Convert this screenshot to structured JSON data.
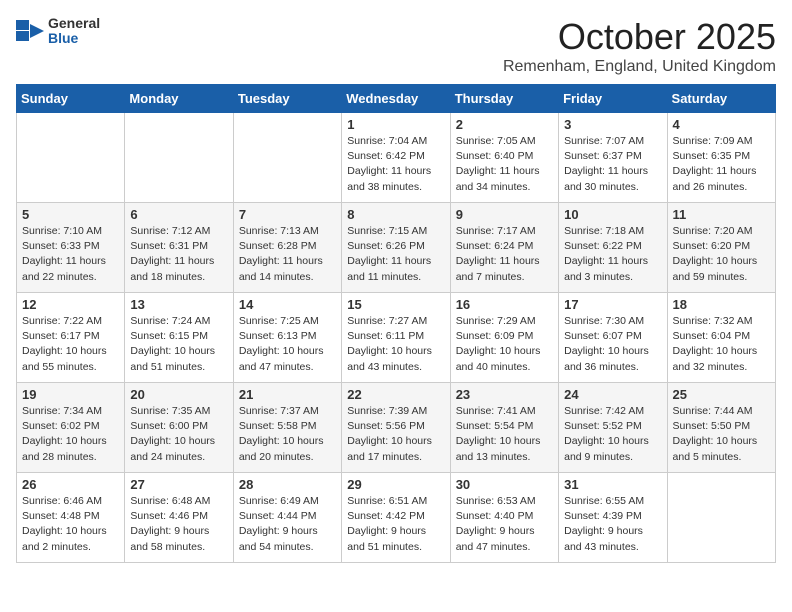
{
  "header": {
    "logo_general": "General",
    "logo_blue": "Blue",
    "month": "October 2025",
    "location": "Remenham, England, United Kingdom"
  },
  "weekdays": [
    "Sunday",
    "Monday",
    "Tuesday",
    "Wednesday",
    "Thursday",
    "Friday",
    "Saturday"
  ],
  "weeks": [
    [
      {
        "day": "",
        "info": ""
      },
      {
        "day": "",
        "info": ""
      },
      {
        "day": "",
        "info": ""
      },
      {
        "day": "1",
        "info": "Sunrise: 7:04 AM\nSunset: 6:42 PM\nDaylight: 11 hours and 38 minutes."
      },
      {
        "day": "2",
        "info": "Sunrise: 7:05 AM\nSunset: 6:40 PM\nDaylight: 11 hours and 34 minutes."
      },
      {
        "day": "3",
        "info": "Sunrise: 7:07 AM\nSunset: 6:37 PM\nDaylight: 11 hours and 30 minutes."
      },
      {
        "day": "4",
        "info": "Sunrise: 7:09 AM\nSunset: 6:35 PM\nDaylight: 11 hours and 26 minutes."
      }
    ],
    [
      {
        "day": "5",
        "info": "Sunrise: 7:10 AM\nSunset: 6:33 PM\nDaylight: 11 hours and 22 minutes."
      },
      {
        "day": "6",
        "info": "Sunrise: 7:12 AM\nSunset: 6:31 PM\nDaylight: 11 hours and 18 minutes."
      },
      {
        "day": "7",
        "info": "Sunrise: 7:13 AM\nSunset: 6:28 PM\nDaylight: 11 hours and 14 minutes."
      },
      {
        "day": "8",
        "info": "Sunrise: 7:15 AM\nSunset: 6:26 PM\nDaylight: 11 hours and 11 minutes."
      },
      {
        "day": "9",
        "info": "Sunrise: 7:17 AM\nSunset: 6:24 PM\nDaylight: 11 hours and 7 minutes."
      },
      {
        "day": "10",
        "info": "Sunrise: 7:18 AM\nSunset: 6:22 PM\nDaylight: 11 hours and 3 minutes."
      },
      {
        "day": "11",
        "info": "Sunrise: 7:20 AM\nSunset: 6:20 PM\nDaylight: 10 hours and 59 minutes."
      }
    ],
    [
      {
        "day": "12",
        "info": "Sunrise: 7:22 AM\nSunset: 6:17 PM\nDaylight: 10 hours and 55 minutes."
      },
      {
        "day": "13",
        "info": "Sunrise: 7:24 AM\nSunset: 6:15 PM\nDaylight: 10 hours and 51 minutes."
      },
      {
        "day": "14",
        "info": "Sunrise: 7:25 AM\nSunset: 6:13 PM\nDaylight: 10 hours and 47 minutes."
      },
      {
        "day": "15",
        "info": "Sunrise: 7:27 AM\nSunset: 6:11 PM\nDaylight: 10 hours and 43 minutes."
      },
      {
        "day": "16",
        "info": "Sunrise: 7:29 AM\nSunset: 6:09 PM\nDaylight: 10 hours and 40 minutes."
      },
      {
        "day": "17",
        "info": "Sunrise: 7:30 AM\nSunset: 6:07 PM\nDaylight: 10 hours and 36 minutes."
      },
      {
        "day": "18",
        "info": "Sunrise: 7:32 AM\nSunset: 6:04 PM\nDaylight: 10 hours and 32 minutes."
      }
    ],
    [
      {
        "day": "19",
        "info": "Sunrise: 7:34 AM\nSunset: 6:02 PM\nDaylight: 10 hours and 28 minutes."
      },
      {
        "day": "20",
        "info": "Sunrise: 7:35 AM\nSunset: 6:00 PM\nDaylight: 10 hours and 24 minutes."
      },
      {
        "day": "21",
        "info": "Sunrise: 7:37 AM\nSunset: 5:58 PM\nDaylight: 10 hours and 20 minutes."
      },
      {
        "day": "22",
        "info": "Sunrise: 7:39 AM\nSunset: 5:56 PM\nDaylight: 10 hours and 17 minutes."
      },
      {
        "day": "23",
        "info": "Sunrise: 7:41 AM\nSunset: 5:54 PM\nDaylight: 10 hours and 13 minutes."
      },
      {
        "day": "24",
        "info": "Sunrise: 7:42 AM\nSunset: 5:52 PM\nDaylight: 10 hours and 9 minutes."
      },
      {
        "day": "25",
        "info": "Sunrise: 7:44 AM\nSunset: 5:50 PM\nDaylight: 10 hours and 5 minutes."
      }
    ],
    [
      {
        "day": "26",
        "info": "Sunrise: 6:46 AM\nSunset: 4:48 PM\nDaylight: 10 hours and 2 minutes."
      },
      {
        "day": "27",
        "info": "Sunrise: 6:48 AM\nSunset: 4:46 PM\nDaylight: 9 hours and 58 minutes."
      },
      {
        "day": "28",
        "info": "Sunrise: 6:49 AM\nSunset: 4:44 PM\nDaylight: 9 hours and 54 minutes."
      },
      {
        "day": "29",
        "info": "Sunrise: 6:51 AM\nSunset: 4:42 PM\nDaylight: 9 hours and 51 minutes."
      },
      {
        "day": "30",
        "info": "Sunrise: 6:53 AM\nSunset: 4:40 PM\nDaylight: 9 hours and 47 minutes."
      },
      {
        "day": "31",
        "info": "Sunrise: 6:55 AM\nSunset: 4:39 PM\nDaylight: 9 hours and 43 minutes."
      },
      {
        "day": "",
        "info": ""
      }
    ]
  ]
}
